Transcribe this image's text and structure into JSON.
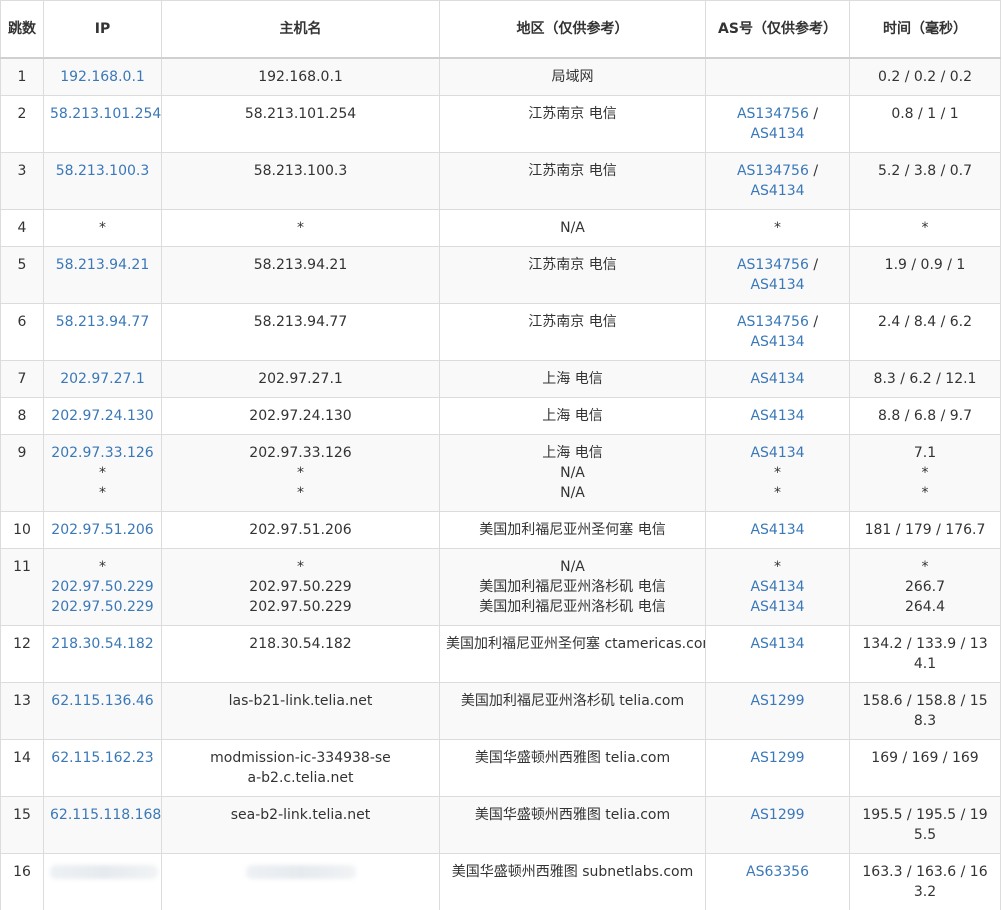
{
  "headers": {
    "hop": "跳数",
    "ip": "IP",
    "hostname": "主机名",
    "region": "地区（仅供参考）",
    "as": "AS号（仅供参考）",
    "time": "时间（毫秒）"
  },
  "rows": [
    {
      "hop": "1",
      "ips": [
        "192.168.0.1"
      ],
      "hosts": [
        "192.168.0.1"
      ],
      "regions": [
        "局域网"
      ],
      "as": [
        []
      ],
      "times": [
        "0.2 / 0.2 / 0.2"
      ]
    },
    {
      "hop": "2",
      "ips": [
        "58.213.101.254"
      ],
      "hosts": [
        "58.213.101.254"
      ],
      "regions": [
        "江苏南京 电信"
      ],
      "as": [
        [
          "AS134756",
          "AS4134"
        ]
      ],
      "times": [
        "0.8 / 1 / 1"
      ]
    },
    {
      "hop": "3",
      "ips": [
        "58.213.100.3"
      ],
      "hosts": [
        "58.213.100.3"
      ],
      "regions": [
        "江苏南京 电信"
      ],
      "as": [
        [
          "AS134756",
          "AS4134"
        ]
      ],
      "times": [
        "5.2 / 3.8 / 0.7"
      ]
    },
    {
      "hop": "4",
      "ips": [
        "*"
      ],
      "hosts": [
        "*"
      ],
      "regions": [
        "N/A"
      ],
      "as": [
        [
          "*"
        ]
      ],
      "times": [
        "*"
      ]
    },
    {
      "hop": "5",
      "ips": [
        "58.213.94.21"
      ],
      "hosts": [
        "58.213.94.21"
      ],
      "regions": [
        "江苏南京 电信"
      ],
      "as": [
        [
          "AS134756",
          "AS4134"
        ]
      ],
      "times": [
        "1.9 / 0.9 / 1"
      ]
    },
    {
      "hop": "6",
      "ips": [
        "58.213.94.77"
      ],
      "hosts": [
        "58.213.94.77"
      ],
      "regions": [
        "江苏南京 电信"
      ],
      "as": [
        [
          "AS134756",
          "AS4134"
        ]
      ],
      "times": [
        "2.4 / 8.4 / 6.2"
      ]
    },
    {
      "hop": "7",
      "ips": [
        "202.97.27.1"
      ],
      "hosts": [
        "202.97.27.1"
      ],
      "regions": [
        "上海 电信"
      ],
      "as": [
        [
          "AS4134"
        ]
      ],
      "times": [
        "8.3 / 6.2 / 12.1"
      ]
    },
    {
      "hop": "8",
      "ips": [
        "202.97.24.130"
      ],
      "hosts": [
        "202.97.24.130"
      ],
      "regions": [
        "上海 电信"
      ],
      "as": [
        [
          "AS4134"
        ]
      ],
      "times": [
        "8.8 / 6.8 / 9.7"
      ]
    },
    {
      "hop": "9",
      "ips": [
        "202.97.33.126",
        "*",
        "*"
      ],
      "hosts": [
        "202.97.33.126",
        "*",
        "*"
      ],
      "regions": [
        "上海 电信",
        "N/A",
        "N/A"
      ],
      "as": [
        [
          "AS4134"
        ],
        [
          "*"
        ],
        [
          "*"
        ]
      ],
      "times": [
        "7.1",
        "*",
        "*"
      ]
    },
    {
      "hop": "10",
      "ips": [
        "202.97.51.206"
      ],
      "hosts": [
        "202.97.51.206"
      ],
      "regions": [
        "美国加利福尼亚州圣何塞 电信"
      ],
      "as": [
        [
          "AS4134"
        ]
      ],
      "times": [
        "181 / 179 / 176.7"
      ]
    },
    {
      "hop": "11",
      "ips": [
        "*",
        "202.97.50.229",
        "202.97.50.229"
      ],
      "hosts": [
        "*",
        "202.97.50.229",
        "202.97.50.229"
      ],
      "regions": [
        "N/A",
        "美国加利福尼亚州洛杉矶 电信",
        "美国加利福尼亚州洛杉矶 电信"
      ],
      "as": [
        [
          "*"
        ],
        [
          "AS4134"
        ],
        [
          "AS4134"
        ]
      ],
      "times": [
        "*",
        "266.7",
        "264.4"
      ]
    },
    {
      "hop": "12",
      "ips": [
        "218.30.54.182"
      ],
      "hosts": [
        "218.30.54.182"
      ],
      "regions": [
        "美国加利福尼亚州圣何塞 ctamericas.com"
      ],
      "as": [
        [
          "AS4134"
        ]
      ],
      "times": [
        "134.2 / 133.9 / 134.1"
      ]
    },
    {
      "hop": "13",
      "ips": [
        "62.115.136.46"
      ],
      "hosts": [
        "las-b21-link.telia.net"
      ],
      "regions": [
        "美国加利福尼亚州洛杉矶 telia.com"
      ],
      "as": [
        [
          "AS1299"
        ]
      ],
      "times": [
        "158.6 / 158.8 / 158.3"
      ]
    },
    {
      "hop": "14",
      "ips": [
        "62.115.162.23"
      ],
      "hosts": [
        "modmission-ic-334938-sea-b2.c.telia.net"
      ],
      "regions": [
        "美国华盛顿州西雅图 telia.com"
      ],
      "as": [
        [
          "AS1299"
        ]
      ],
      "times": [
        "169 / 169 / 169"
      ]
    },
    {
      "hop": "15",
      "ips": [
        "62.115.118.168"
      ],
      "hosts": [
        "sea-b2-link.telia.net"
      ],
      "regions": [
        "美国华盛顿州西雅图 telia.com"
      ],
      "as": [
        [
          "AS1299"
        ]
      ],
      "times": [
        "195.5 / 195.5 / 195.5"
      ]
    },
    {
      "hop": "16",
      "ips": [
        ""
      ],
      "hosts": [
        ""
      ],
      "regions": [
        "美国华盛顿州西雅图 subnetlabs.com"
      ],
      "as": [
        [
          "AS63356"
        ]
      ],
      "times": [
        "163.3 / 163.6 / 163.2"
      ]
    }
  ],
  "colors": {
    "link": "#3a78b8",
    "row_alt": "#f9f9f9",
    "border": "#dcdcdc"
  }
}
